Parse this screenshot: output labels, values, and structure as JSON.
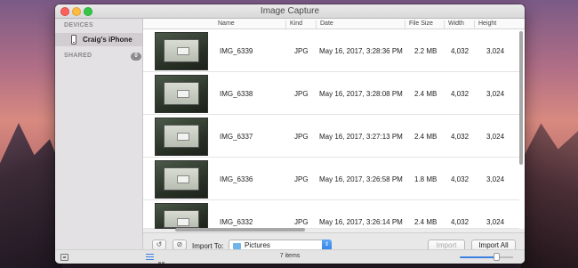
{
  "window": {
    "title": "Image Capture"
  },
  "sidebar": {
    "devices_heading": "DEVICES",
    "device_name": "Craig's iPhone",
    "shared_heading": "SHARED",
    "shared_count": "0"
  },
  "columns": {
    "name": "Name",
    "kind": "Kind",
    "date": "Date",
    "size": "File Size",
    "width": "Width",
    "height": "Height"
  },
  "rows": [
    {
      "name": "IMG_6339",
      "kind": "JPG",
      "date": "May 16, 2017, 3:28:36 PM",
      "size": "2.2 MB",
      "width": "4,032",
      "height": "3,024"
    },
    {
      "name": "IMG_6338",
      "kind": "JPG",
      "date": "May 16, 2017, 3:28:08 PM",
      "size": "2.4 MB",
      "width": "4,032",
      "height": "3,024"
    },
    {
      "name": "IMG_6337",
      "kind": "JPG",
      "date": "May 16, 2017, 3:27:13 PM",
      "size": "2.4 MB",
      "width": "4,032",
      "height": "3,024"
    },
    {
      "name": "IMG_6336",
      "kind": "JPG",
      "date": "May 16, 2017, 3:26:58 PM",
      "size": "1.8 MB",
      "width": "4,032",
      "height": "3,024"
    },
    {
      "name": "IMG_6332",
      "kind": "JPG",
      "date": "May 16, 2017, 3:26:14 PM",
      "size": "2.4 MB",
      "width": "4,032",
      "height": "3,024"
    }
  ],
  "toolbar": {
    "import_to_label": "Import To:",
    "destination": "Pictures",
    "import_label": "Import",
    "import_all_label": "Import All"
  },
  "status": {
    "items_count": "7 items"
  },
  "icons": {
    "rotate": "rotate-left-icon",
    "delete": "delete-icon",
    "folder": "folder-icon",
    "popup_arrow": "chevron-updown-icon",
    "list_view": "list-view-icon",
    "grid_view": "grid-view-icon",
    "sidebar_toggle": "sidebar-toggle-icon"
  },
  "colors": {
    "accent": "#3b82e0",
    "selection": "#d2cdd1"
  }
}
